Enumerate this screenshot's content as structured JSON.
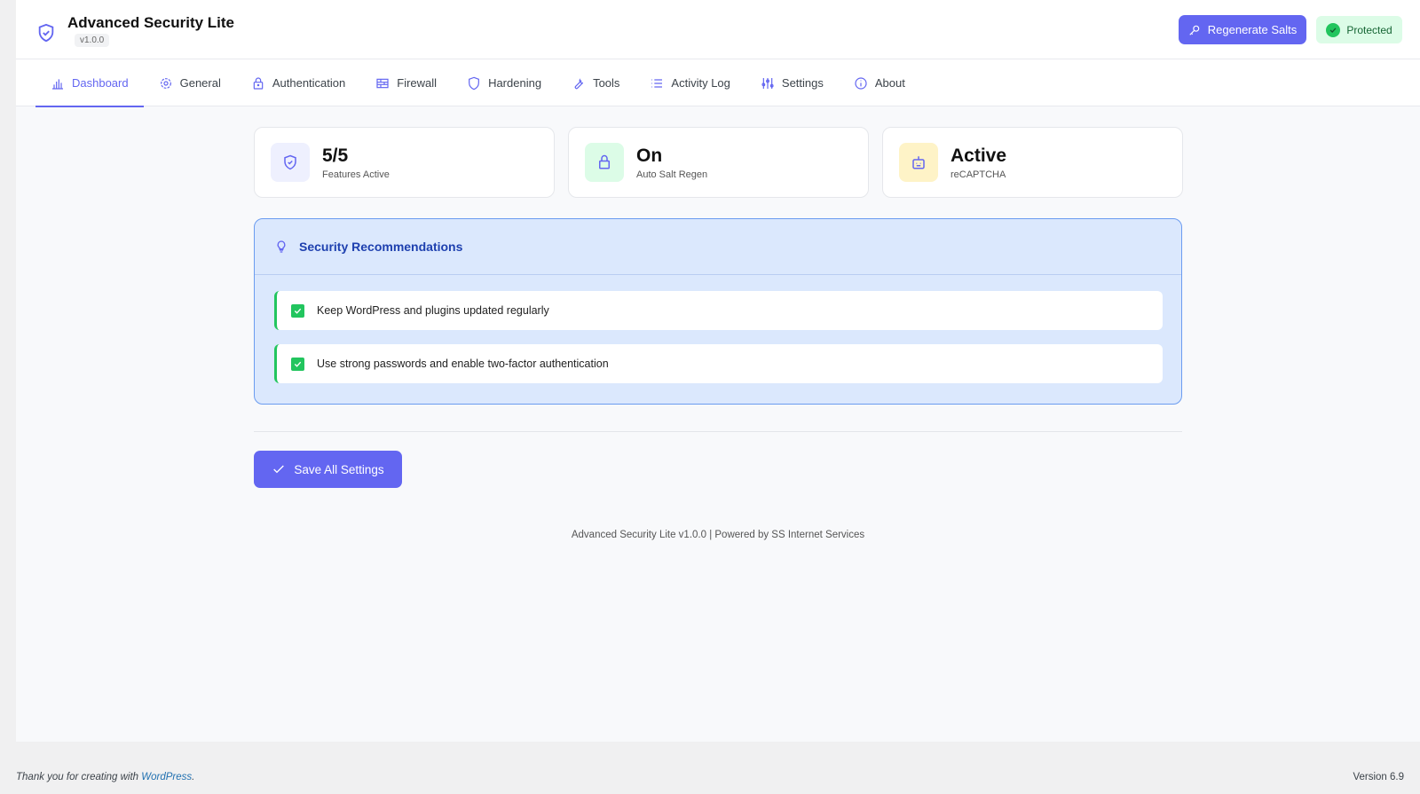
{
  "header": {
    "title": "Advanced Security Lite",
    "version": "v1.0.0",
    "regenerate_label": "Regenerate Salts",
    "status_label": "Protected"
  },
  "nav": {
    "tabs": [
      {
        "label": "Dashboard",
        "icon": "chart-icon"
      },
      {
        "label": "General",
        "icon": "gear-icon"
      },
      {
        "label": "Authentication",
        "icon": "lock-icon"
      },
      {
        "label": "Firewall",
        "icon": "firewall-icon"
      },
      {
        "label": "Hardening",
        "icon": "shield-icon"
      },
      {
        "label": "Tools",
        "icon": "wrench-icon"
      },
      {
        "label": "Activity Log",
        "icon": "list-icon"
      },
      {
        "label": "Settings",
        "icon": "sliders-icon"
      },
      {
        "label": "About",
        "icon": "info-icon"
      }
    ],
    "active": "Dashboard"
  },
  "cards": [
    {
      "value": "5/5",
      "label": "Features Active"
    },
    {
      "value": "On",
      "label": "Auto Salt Regen"
    },
    {
      "value": "Active",
      "label": "reCAPTCHA"
    }
  ],
  "recommendations": {
    "title": "Security Recommendations",
    "items": [
      "Keep WordPress and plugins updated regularly",
      "Use strong passwords and enable two-factor authentication"
    ]
  },
  "save_label": "Save All Settings",
  "footer": "Advanced Security Lite v1.0.0 | Powered by SS Internet Services",
  "wp_footer": {
    "thanks": "Thank you for creating with ",
    "link": "WordPress",
    "period": ".",
    "version": "Version 6.9"
  },
  "colors": {
    "accent": "#6366f1",
    "success": "#22c55e"
  }
}
